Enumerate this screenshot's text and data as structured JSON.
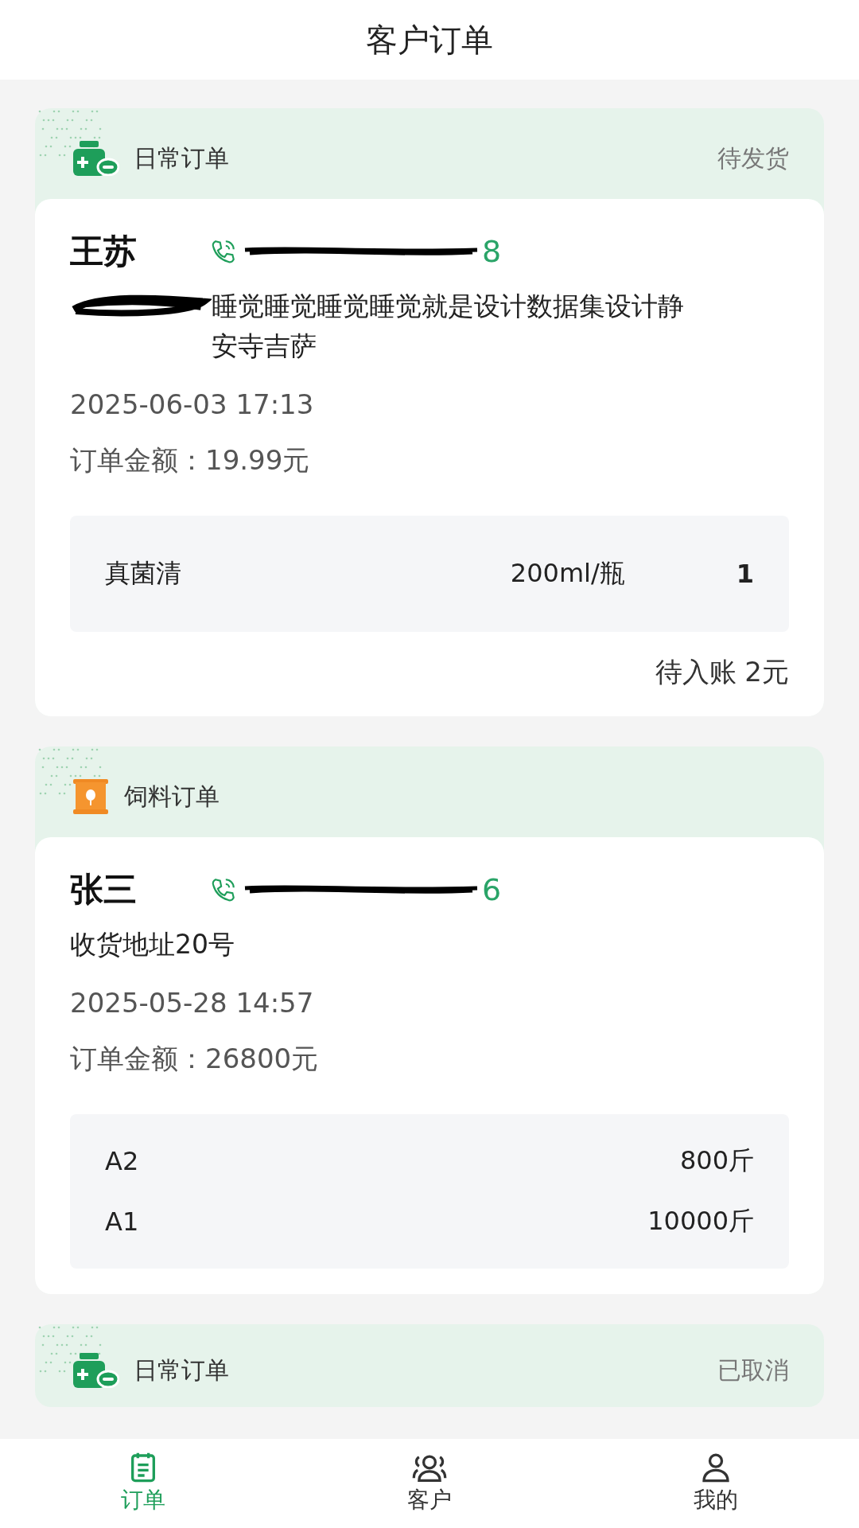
{
  "header": {
    "title": "客户订单"
  },
  "orders": [
    {
      "kind": "daily",
      "type_label": "日常订单",
      "status": "待发货",
      "customer": "王苏",
      "phone": "8",
      "phone_redacted": true,
      "address": "睡觉睡觉睡觉睡觉就是设计数据集设计静安寺吉萨",
      "address_redacted": true,
      "partial": false,
      "time": "2025-06-03 17:13",
      "amount": "订单金额：19.99元",
      "items": [
        {
          "name": "真菌清",
          "spec": "200ml/瓶",
          "quantity": "1"
        }
      ],
      "pending": "待入账 2元"
    },
    {
      "kind": "feed",
      "type_label": "饲料订单",
      "customer": "张三",
      "phone": "6",
      "phone_redacted": true,
      "address": "收货地址20号",
      "address_redacted": false,
      "partial": false,
      "time": "2025-05-28 14:57",
      "amount": "订单金额：26800元",
      "items": [
        {
          "name": "A2",
          "quantity": "800斤"
        },
        {
          "name": "A1",
          "quantity": "10000斤"
        }
      ]
    },
    {
      "kind": "daily",
      "type_label": "日常订单",
      "status": "已取消",
      "partial": true
    }
  ],
  "tabbar": [
    {
      "label": "订单",
      "selected": true
    },
    {
      "label": "客户",
      "selected": false
    },
    {
      "label": "我的",
      "selected": false
    }
  ]
}
